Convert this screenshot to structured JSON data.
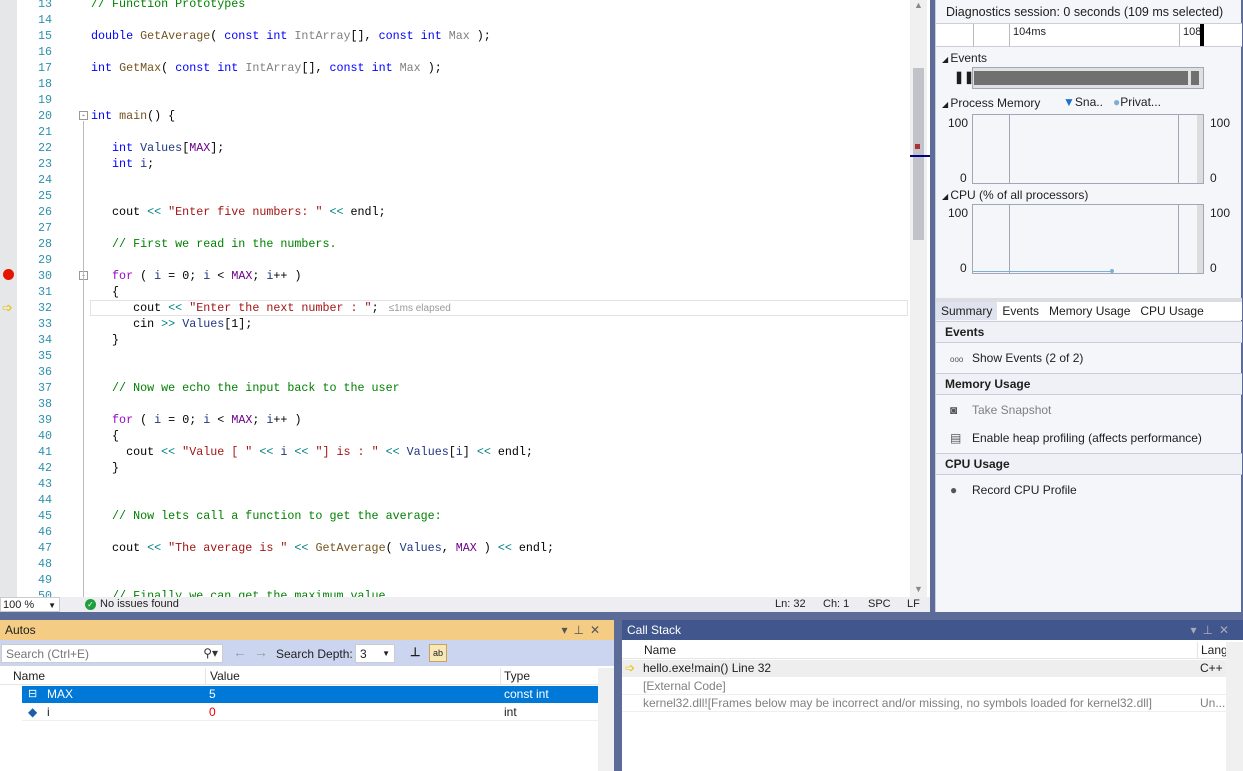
{
  "editor": {
    "first_line": 13,
    "current_line": 32,
    "breakpoint_line": 30,
    "elapsed_hint": "≤1ms elapsed",
    "lines": [
      [
        [
          "cm",
          "// Function Prototypes"
        ]
      ],
      [],
      [
        [
          "k",
          "double "
        ],
        [
          "f",
          "GetAverage"
        ],
        [
          "t",
          "( "
        ],
        [
          "k",
          "const int "
        ],
        [
          "p",
          "IntArray"
        ],
        [
          "t",
          "[], "
        ],
        [
          "k",
          "const int "
        ],
        [
          "p",
          "Max"
        ],
        [
          "t",
          " );"
        ]
      ],
      [],
      [
        [
          "k",
          "int "
        ],
        [
          "f",
          "GetMax"
        ],
        [
          "t",
          "( "
        ],
        [
          "k",
          "const int "
        ],
        [
          "p",
          "IntArray"
        ],
        [
          "t",
          "[], "
        ],
        [
          "k",
          "const int "
        ],
        [
          "p",
          "Max"
        ],
        [
          "t",
          " );"
        ]
      ],
      [],
      [],
      [
        [
          "k",
          "int "
        ],
        [
          "f",
          "main"
        ],
        [
          "t",
          "() {"
        ]
      ],
      [],
      [
        [
          "t",
          "   "
        ],
        [
          "k",
          "int "
        ],
        [
          "v",
          "Values"
        ],
        [
          "t",
          "["
        ],
        [
          "m",
          "MAX"
        ],
        [
          "t",
          "];"
        ]
      ],
      [
        [
          "t",
          "   "
        ],
        [
          "k",
          "int "
        ],
        [
          "v",
          "i"
        ],
        [
          "t",
          ";"
        ]
      ],
      [],
      [],
      [
        [
          "t",
          "   cout "
        ],
        [
          "o",
          "<<"
        ],
        [
          "s",
          " \"Enter five numbers: \""
        ],
        [
          "t",
          " "
        ],
        [
          "o",
          "<<"
        ],
        [
          "t",
          " endl;"
        ]
      ],
      [],
      [
        [
          "cm",
          "   // First we read in the numbers."
        ]
      ],
      [],
      [
        [
          "t",
          "   "
        ],
        [
          "c",
          "for"
        ],
        [
          "t",
          " ( "
        ],
        [
          "v",
          "i"
        ],
        [
          "t",
          " = 0; "
        ],
        [
          "v",
          "i"
        ],
        [
          "t",
          " < "
        ],
        [
          "m",
          "MAX"
        ],
        [
          "t",
          "; "
        ],
        [
          "v",
          "i"
        ],
        [
          "t",
          "++ )"
        ]
      ],
      [
        [
          "t",
          "   {"
        ]
      ],
      [
        [
          "t",
          "      cout "
        ],
        [
          "o",
          "<<"
        ],
        [
          "s",
          " \"Enter the next number : \""
        ],
        [
          "t",
          ";"
        ]
      ],
      [
        [
          "t",
          "      cin "
        ],
        [
          "o",
          ">>"
        ],
        [
          "t",
          " "
        ],
        [
          "v",
          "Values"
        ],
        [
          "t",
          "[1];"
        ]
      ],
      [
        [
          "t",
          "   }"
        ]
      ],
      [],
      [],
      [
        [
          "cm",
          "   // Now we echo the input back to the user"
        ]
      ],
      [],
      [
        [
          "t",
          "   "
        ],
        [
          "c",
          "for"
        ],
        [
          "t",
          " ( "
        ],
        [
          "v",
          "i"
        ],
        [
          "t",
          " = 0; "
        ],
        [
          "v",
          "i"
        ],
        [
          "t",
          " < "
        ],
        [
          "m",
          "MAX"
        ],
        [
          "t",
          "; "
        ],
        [
          "v",
          "i"
        ],
        [
          "t",
          "++ )"
        ]
      ],
      [
        [
          "t",
          "   {"
        ]
      ],
      [
        [
          "t",
          "     cout "
        ],
        [
          "o",
          "<<"
        ],
        [
          "s",
          " \"Value [ \""
        ],
        [
          "t",
          " "
        ],
        [
          "o",
          "<<"
        ],
        [
          "t",
          " "
        ],
        [
          "v",
          "i"
        ],
        [
          "t",
          " "
        ],
        [
          "o",
          "<<"
        ],
        [
          "s",
          " \"] is : \""
        ],
        [
          "t",
          " "
        ],
        [
          "o",
          "<<"
        ],
        [
          "t",
          " "
        ],
        [
          "v",
          "Values"
        ],
        [
          "t",
          "["
        ],
        [
          "v",
          "i"
        ],
        [
          "t",
          "] "
        ],
        [
          "o",
          "<<"
        ],
        [
          "t",
          " endl;"
        ]
      ],
      [
        [
          "t",
          "   }"
        ]
      ],
      [],
      [],
      [
        [
          "cm",
          "   // Now lets call a function to get the average:"
        ]
      ],
      [],
      [
        [
          "t",
          "   cout "
        ],
        [
          "o",
          "<<"
        ],
        [
          "s",
          " \"The average is \""
        ],
        [
          "t",
          " "
        ],
        [
          "o",
          "<<"
        ],
        [
          "t",
          " "
        ],
        [
          "f",
          "GetAverage"
        ],
        [
          "t",
          "( "
        ],
        [
          "v",
          "Values"
        ],
        [
          "t",
          ", "
        ],
        [
          "m",
          "MAX"
        ],
        [
          "t",
          " ) "
        ],
        [
          "o",
          "<<"
        ],
        [
          "t",
          " endl;"
        ]
      ],
      [],
      [],
      [
        [
          "cm",
          "   // Finally we can get the maximum value"
        ]
      ]
    ]
  },
  "status": {
    "zoom": "100 %",
    "issues": "No issues found",
    "ln": "Ln: 32",
    "ch": "Ch: 1",
    "spc": "SPC",
    "lf": "LF"
  },
  "diagnostics": {
    "title": "Diagnostics session: 0 seconds (109 ms selected)",
    "ruler_labels": [
      "104ms",
      "108"
    ],
    "events_label": "Events",
    "memory_label": "Process Memory",
    "legend": [
      "Sna..",
      "Privat..."
    ],
    "cpu_label": "CPU (% of all processors)",
    "axis_max": "100",
    "axis_min": "0",
    "tabs": [
      "Summary",
      "Events",
      "Memory Usage",
      "CPU Usage"
    ],
    "active_tab": "Summary",
    "sections": {
      "events": {
        "header": "Events",
        "items": [
          "Show Events (2 of 2)"
        ]
      },
      "memory": {
        "header": "Memory Usage",
        "items": [
          "Take Snapshot",
          "Enable heap profiling (affects performance)"
        ]
      },
      "cpu": {
        "header": "CPU Usage",
        "items": [
          "Record CPU Profile"
        ]
      }
    }
  },
  "autos": {
    "title": "Autos",
    "search_placeholder": "Search (Ctrl+E)",
    "depth_label": "Search Depth:",
    "depth_value": "3",
    "columns": [
      "Name",
      "Value",
      "Type"
    ],
    "rows": [
      {
        "name": "MAX",
        "value": "5",
        "type": "const int",
        "selected": true
      },
      {
        "name": "i",
        "value": "0",
        "type": "int",
        "changed": true
      }
    ]
  },
  "callstack": {
    "title": "Call Stack",
    "columns": [
      "Name",
      "Lang"
    ],
    "rows": [
      {
        "name": "hello.exe!main() Line 32",
        "lang": "C++",
        "current": true
      },
      {
        "name": "[External Code]",
        "lang": ""
      },
      {
        "name": "kernel32.dll![Frames below may be incorrect and/or missing, no symbols loaded for kernel32.dll]",
        "lang": "Un..."
      }
    ]
  },
  "colors": {
    "accent": "#007acc",
    "selection": "#0078d7",
    "autos_title": "#f5cc84",
    "callstack_title": "#40568d"
  }
}
